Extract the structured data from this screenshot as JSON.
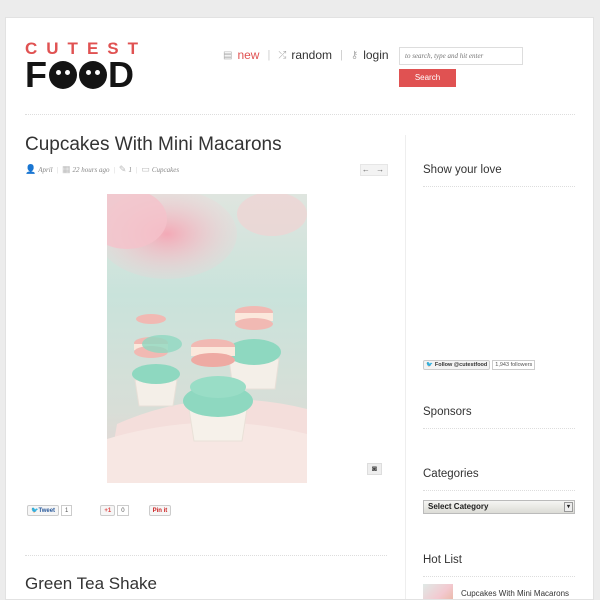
{
  "header": {
    "logo_top": "CUTEST",
    "logo_bottom_start": "F",
    "logo_bottom_end": "D",
    "nav": [
      {
        "label": "new",
        "icon": "page-icon",
        "active": true
      },
      {
        "label": "random",
        "icon": "shuffle-icon",
        "active": false
      },
      {
        "label": "login",
        "icon": "key-icon",
        "active": false
      }
    ],
    "search": {
      "placeholder": "to search, type and hit enter",
      "button": "Search"
    }
  },
  "post": {
    "title": "Cupcakes With Mini Macarons",
    "meta": {
      "author": "April",
      "time": "22 hours ago",
      "comments": "1",
      "category": "Cupcakes"
    },
    "arrows": "← →",
    "social": {
      "tweet_label": "Tweet",
      "tweet_count": "1",
      "gplus_label": "+1",
      "gplus_count": "0",
      "pin_label": "Pin it"
    }
  },
  "next_post": {
    "title": "Green Tea Shake"
  },
  "sidebar": {
    "show_love": "Show your love",
    "follow_label": "Follow @cutestfood",
    "followers": "1,943 followers",
    "sponsors": "Sponsors",
    "categories": "Categories",
    "select_value": "Select Category",
    "hot_list": "Hot List",
    "hot_items": [
      {
        "title": "Cupcakes With Mini Macarons"
      }
    ]
  },
  "colors": {
    "accent": "#e05252",
    "mint": "#8ed8c0",
    "pink": "#f1b9b3"
  }
}
